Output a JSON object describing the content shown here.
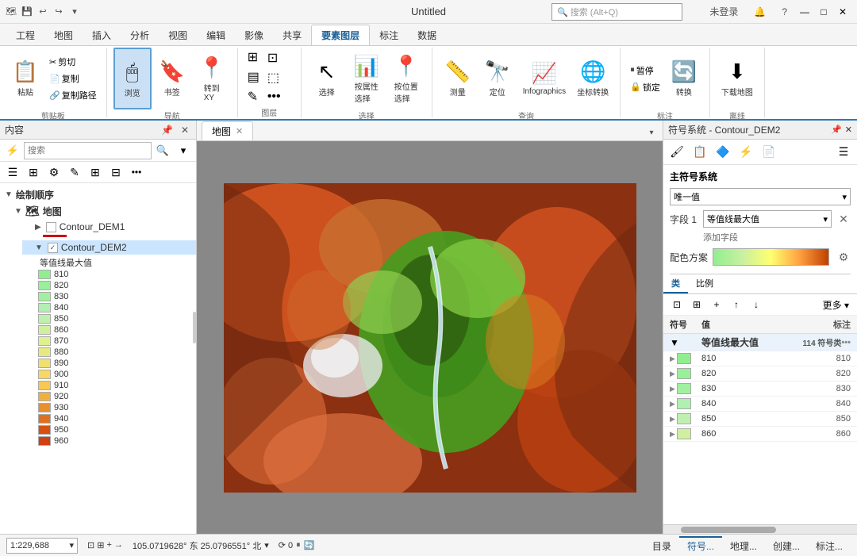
{
  "titleBar": {
    "title": "Untitled",
    "searchPlaceholder": "搜索 (Alt+Q)",
    "userLabel": "未登录",
    "windowBtns": [
      "—",
      "□",
      "✕"
    ]
  },
  "ribbonTabs": [
    "工程",
    "地图",
    "插入",
    "分析",
    "视图",
    "编辑",
    "影像",
    "共享",
    "要素图层",
    "标注",
    "数据"
  ],
  "activeRibbonTab": "要素图层",
  "ribbonGroups": [
    {
      "name": "剪贴板",
      "items": [
        "粘贴",
        "剪切",
        "复制",
        "复制路径"
      ]
    },
    {
      "name": "导航",
      "items": [
        "浏览",
        "书签",
        "转到XY"
      ]
    },
    {
      "name": "图层",
      "items": []
    },
    {
      "name": "选择",
      "items": [
        "选择",
        "按属性选择",
        "按位置选择"
      ]
    },
    {
      "name": "查询",
      "items": [
        "测量",
        "定位",
        "Infographics",
        "坐标转换"
      ]
    },
    {
      "name": "标注",
      "items": [
        "暂停",
        "锁定",
        "转换"
      ]
    },
    {
      "name": "离线",
      "items": [
        "下载地图"
      ]
    }
  ],
  "contentsPanel": {
    "title": "内容",
    "searchPlaceholder": "搜索",
    "drawingOrder": "绘制顺序",
    "mapLabel": "地图",
    "layers": [
      {
        "name": "Contour_DEM1",
        "checked": false,
        "expanded": false
      },
      {
        "name": "Contour_DEM2",
        "checked": true,
        "expanded": true,
        "selected": true
      }
    ],
    "fieldName": "等值线最大值",
    "values": [
      "810",
      "820",
      "830",
      "840",
      "850",
      "860",
      "870",
      "880",
      "890",
      "900",
      "910",
      "920",
      "930",
      "940",
      "950",
      "960"
    ],
    "colors": [
      "#90ee90",
      "#98f098",
      "#a0f0a0",
      "#b0f0b0",
      "#c0f0b0",
      "#d0f0a0",
      "#e0f090",
      "#e8e880",
      "#f0e070",
      "#f8d860",
      "#f8c850",
      "#f0b040",
      "#e89030",
      "#e07020",
      "#d85010",
      "#d04010"
    ]
  },
  "mapView": {
    "tabLabel": "地图"
  },
  "symbolPanel": {
    "title": "符号系统 - Contour_DEM2",
    "primarySystem": "主符号系统",
    "uniqueValue": "唯一值",
    "field1Label": "字段 1",
    "field1Value": "等值线最大值",
    "addFieldLabel": "添加字段",
    "colorSchemeLabel": "配色方案",
    "tabs": [
      "类",
      "比例"
    ],
    "activeTab": "类",
    "tableColumns": [
      "符号",
      "值",
      "标注"
    ],
    "headerRow": {
      "field": "等值线最大值",
      "count": "114 符号类",
      "moreBtn": "•••"
    },
    "rows": [
      {
        "value": "810",
        "label": "810"
      },
      {
        "value": "820",
        "label": "820"
      },
      {
        "value": "830",
        "label": "830"
      },
      {
        "value": "840",
        "label": "840"
      },
      {
        "value": "850",
        "label": "850"
      },
      {
        "value": "860",
        "label": "860"
      }
    ],
    "rowColors": [
      "#90ee90",
      "#98f098",
      "#a0f0a0",
      "#b0f0b0",
      "#c0f0b0",
      "#d0f0a0"
    ],
    "bottomTabs": [
      "目录",
      "符号...",
      "地理...",
      "创建...",
      "标注..."
    ]
  },
  "statusBar": {
    "scale": "1:229,688",
    "coordinates": "105.0719628° 东 25.0796551° 北",
    "bottomTabs": [
      "目录",
      "符号...",
      "地理...",
      "创建...",
      "标注..."
    ]
  }
}
